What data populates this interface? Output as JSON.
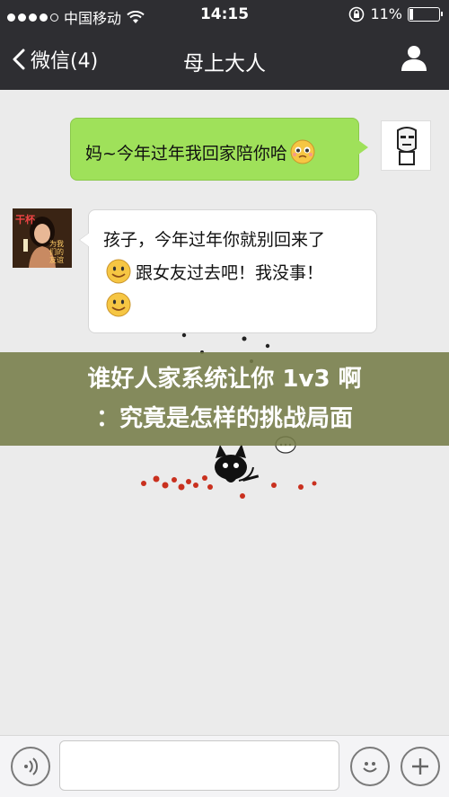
{
  "status": {
    "carrier": "中国移动",
    "time": "14:15",
    "battery": "11%"
  },
  "nav": {
    "back_label": "微信(4)",
    "title": "母上大人"
  },
  "messages": {
    "me_text": "妈~今年过年我回家陪你哈",
    "mom_line1": "孩子，今年过年你就别回来了",
    "mom_line2": "跟女友过去吧！我没事！"
  },
  "avatar_mom": {
    "tag": "干杯",
    "caption": "为我们的友谊"
  },
  "overlay": {
    "line1": "谁好人家系统让你 1v3 啊",
    "line2": "：究竟是怎样的挑战局面"
  }
}
